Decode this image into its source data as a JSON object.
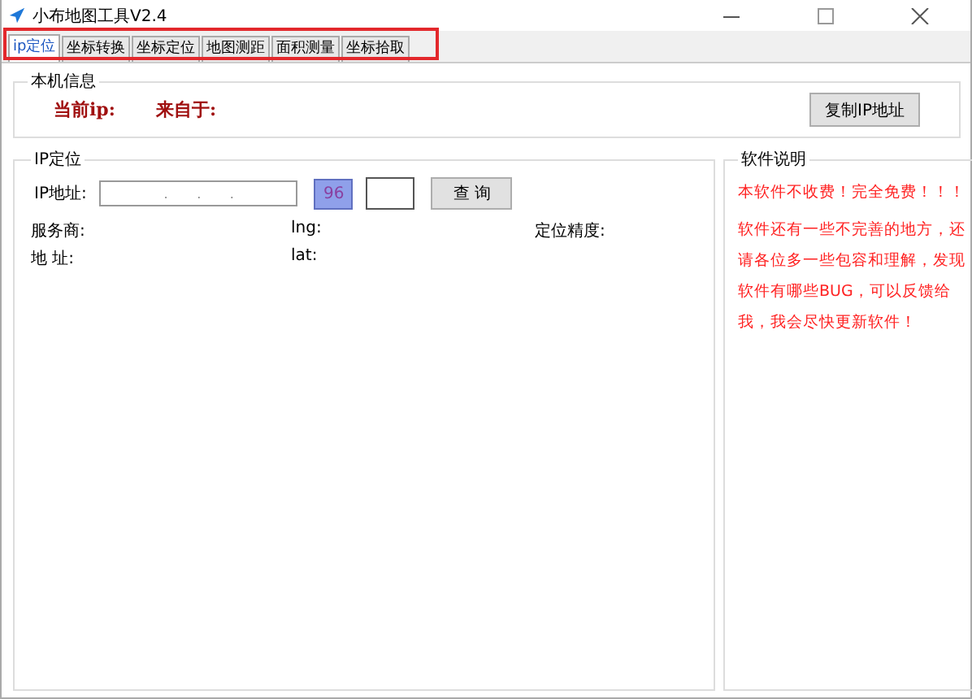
{
  "window": {
    "title": "小布地图工具V2.4"
  },
  "tabs": [
    {
      "label": "ip定位",
      "selected": true
    },
    {
      "label": "坐标转换",
      "selected": false
    },
    {
      "label": "坐标定位",
      "selected": false
    },
    {
      "label": "地图测距",
      "selected": false
    },
    {
      "label": "面积测量",
      "selected": false
    },
    {
      "label": "坐标拾取",
      "selected": false
    }
  ],
  "local_info": {
    "title": "本机信息",
    "current_ip_label": "当前ip:",
    "source_label": "来自于:",
    "copy_button": "复制IP地址"
  },
  "ip_locate": {
    "title": "IP定位",
    "ip_label": "IP地址:",
    "ip_value": ".       .       .",
    "captcha": "96",
    "query_button": "查 询",
    "labels": [
      "服务商:",
      "lng:",
      "定位精度:",
      "地 址:",
      "lat:"
    ]
  },
  "about": {
    "title": "软件说明",
    "lines": [
      "本软件不收费！完全免费！！！",
      "软件还有一些不完善的地方，还请各位多一些包容和理解，发现软件有哪些BUG，可以反馈给我，我会尽快更新软件！"
    ]
  }
}
